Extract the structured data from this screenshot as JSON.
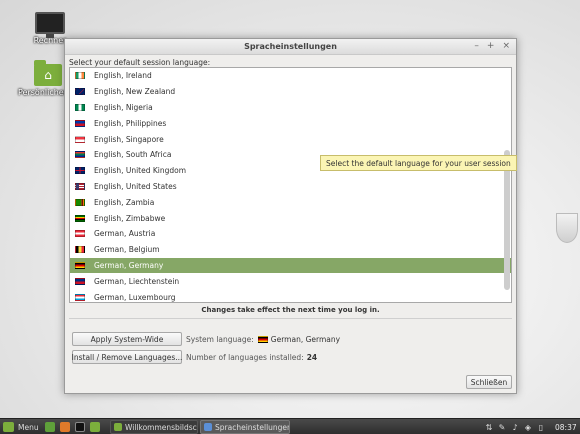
{
  "desktop": {
    "icons": [
      {
        "label": "Rechner",
        "icon": "monitor-icon"
      },
      {
        "label": "Persönlicher Ordner",
        "icon": "home-folder-icon"
      }
    ]
  },
  "window": {
    "title": "Spracheinstellungen",
    "controls": {
      "minimize": "–",
      "maximize": "+",
      "close": "×"
    },
    "prompt": "Select your default session language:",
    "languages": [
      {
        "label": "English, Ireland",
        "flag": "ie"
      },
      {
        "label": "English, New Zealand",
        "flag": "nz"
      },
      {
        "label": "English, Nigeria",
        "flag": "ng"
      },
      {
        "label": "English, Philippines",
        "flag": "ph"
      },
      {
        "label": "English, Singapore",
        "flag": "sg"
      },
      {
        "label": "English, South Africa",
        "flag": "za"
      },
      {
        "label": "English, United Kingdom",
        "flag": "gb"
      },
      {
        "label": "English, United States",
        "flag": "us"
      },
      {
        "label": "English, Zambia",
        "flag": "zm"
      },
      {
        "label": "English, Zimbabwe",
        "flag": "zw"
      },
      {
        "label": "German, Austria",
        "flag": "at"
      },
      {
        "label": "German, Belgium",
        "flag": "be"
      },
      {
        "label": "German, Germany",
        "flag": "de",
        "selected": true
      },
      {
        "label": "German, Liechtenstein",
        "flag": "li"
      },
      {
        "label": "German, Luxembourg",
        "flag": "lu"
      }
    ],
    "tooltip": "Select the default language for your user session",
    "notice": "Changes take effect the next time you log in.",
    "apply_button": "Apply System-Wide",
    "install_button": "Install / Remove Languages...",
    "system_language_label": "System language:",
    "system_language_value": "German, Germany",
    "installed_label": "Number of languages installed:",
    "installed_count": "24",
    "close_button": "Schließen"
  },
  "taskbar": {
    "menu_label": "Menu",
    "tasks": [
      {
        "label": "Willkommensbildsc...",
        "active": false
      },
      {
        "label": "Spracheinstellungen",
        "active": true
      }
    ],
    "clock": "08:37"
  },
  "colors": {
    "selection": "#86a766",
    "tooltip_bg": "#fbf5b4",
    "mint_green": "#7cae3c"
  }
}
